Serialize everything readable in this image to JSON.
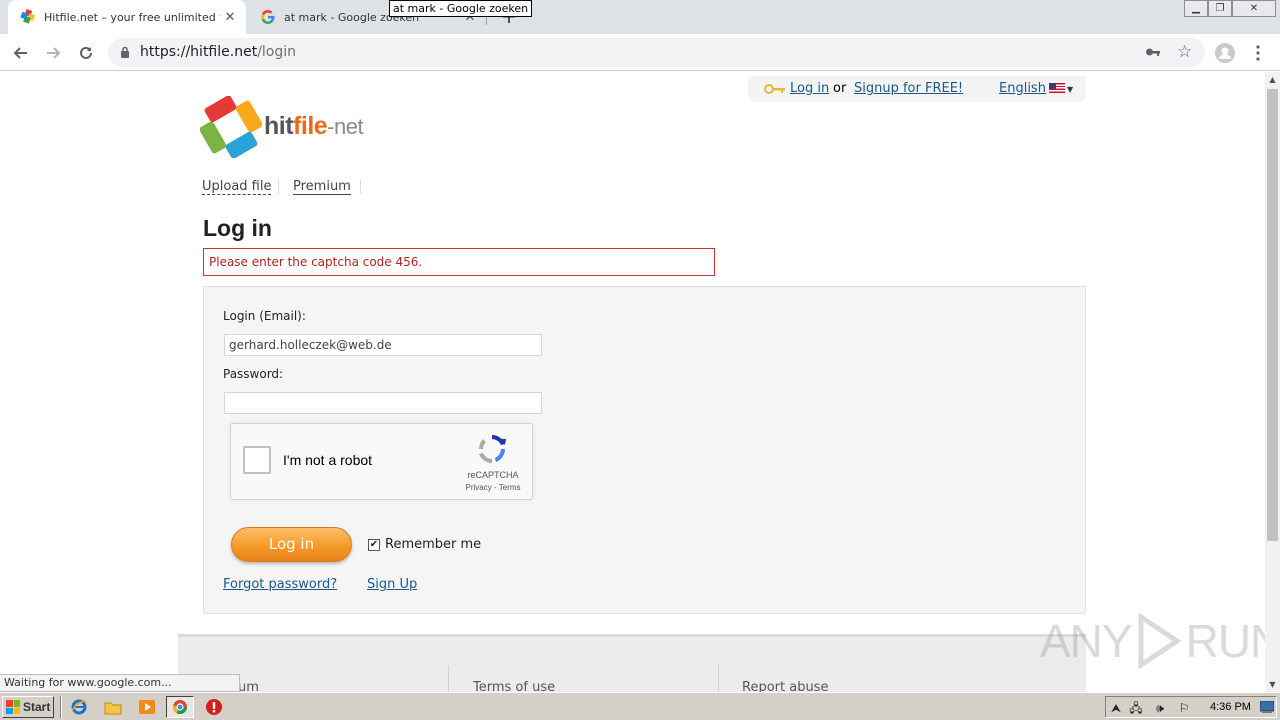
{
  "browser": {
    "tabs": [
      {
        "title": "Hitfile.net – your free unlimited file s",
        "active": true
      },
      {
        "title": "at mark - Google zoeken",
        "active": false
      }
    ],
    "tooltip": "at mark - Google zoeken",
    "url_host": "https://hitfile.net",
    "url_path": "/login",
    "status": "Waiting for www.google.com..."
  },
  "header": {
    "login_link": "Log in",
    "or_text": "or",
    "signup_link": "Signup for FREE!",
    "language": "English"
  },
  "logo": {
    "part1": "hit",
    "part2": "file",
    "part3": "-net"
  },
  "nav": {
    "upload": "Upload file",
    "premium": "Premium"
  },
  "page": {
    "title": "Log in",
    "error": "Please enter the captcha code 456."
  },
  "form": {
    "email_label": "Login (Email):",
    "email_value": "gerhard.holleczek@web.de",
    "password_label": "Password:",
    "password_value": "",
    "captcha_text": "I'm not a robot",
    "captcha_brand": "reCAPTCHA",
    "captcha_terms": "Privacy - Terms",
    "login_button": "Log in",
    "remember_label": "Remember me",
    "remember_checked": true,
    "forgot_link": "Forgot password?",
    "signup_link": "Sign Up"
  },
  "footer": {
    "links": [
      "um",
      "Terms of use",
      "Report abuse"
    ]
  },
  "watermark": {
    "left": "ANY",
    "right": "RUN"
  },
  "taskbar": {
    "start_label": "Start",
    "clock": "4:36 PM"
  },
  "colors": {
    "accent_orange": "#f49a2a",
    "link_blue": "#1a5a88",
    "error_red": "#cc3333"
  }
}
